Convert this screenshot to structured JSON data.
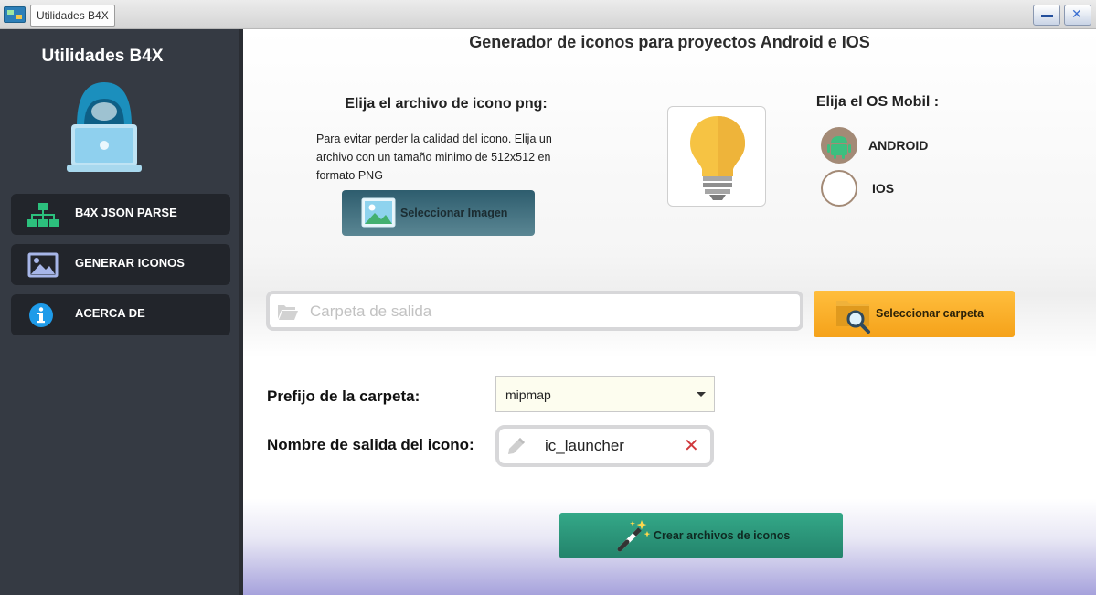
{
  "window": {
    "title": "Utilidades B4X",
    "controls": {
      "minimize_icon": "minimize-icon",
      "close_icon": "close-icon"
    }
  },
  "sidebar": {
    "title": "Utilidades B4X",
    "avatar_icon": "hacker-laptop-icon",
    "items": [
      {
        "label": "B4X JSON PARSE",
        "icon": "sitemap-icon",
        "icon_color": "#2cc07d"
      },
      {
        "label": "GENERAR ICONOS",
        "icon": "image-icon",
        "icon_color": "#a7b6e8"
      },
      {
        "label": "ACERCA DE",
        "icon": "info-icon",
        "icon_color": "#1e9be9"
      }
    ]
  },
  "main": {
    "title": "Generador de iconos para proyectos Android e IOS",
    "png_section": {
      "heading": "Elija el archivo de icono png:",
      "description": "Para evitar perder la calidad del icono. Elija un archivo con un tamaño minimo de 512x512 en formato PNG",
      "select_image_label": "Seleccionar Imagen",
      "preview_icon": "lightbulb-icon"
    },
    "os_section": {
      "heading": "Elija el OS Mobil :",
      "options": [
        {
          "label": "ANDROID",
          "selected": true
        },
        {
          "label": "IOS",
          "selected": false
        }
      ]
    },
    "output_folder": {
      "placeholder": "Carpeta de salida",
      "value": "",
      "select_folder_label": "Seleccionar carpeta"
    },
    "prefix": {
      "label": "Prefijo de la carpeta:",
      "value": "mipmap"
    },
    "icon_name": {
      "label": "Nombre de salida del icono:",
      "value": "ic_launcher"
    },
    "create_label": "Crear archivos de iconos",
    "colors": {
      "sidebar_bg": "#353a43",
      "nav_bg": "#22252b",
      "radio_accent": "#a38a76",
      "folder_button": "#f5a21a",
      "create_button": "#2a9679",
      "clear_icon": "#d0393c"
    }
  }
}
